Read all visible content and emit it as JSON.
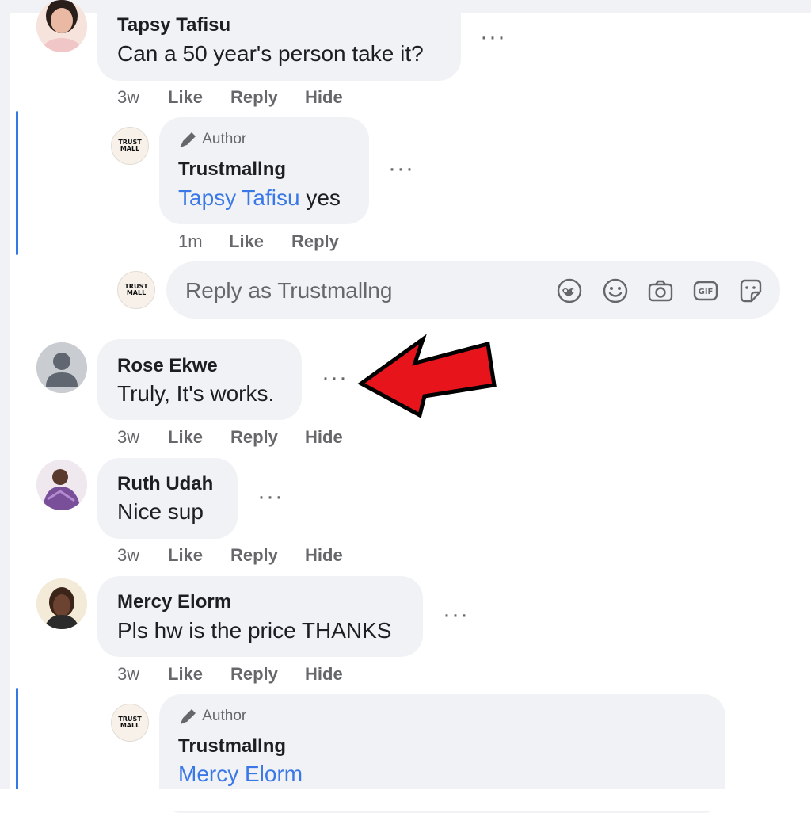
{
  "comments": [
    {
      "name": "Tapsy Tafisu",
      "text": "Can a 50 year's person take it?",
      "time": "3w",
      "like": "Like",
      "reply": "Reply",
      "hide": "Hide",
      "menu": "···"
    },
    {
      "name": "Rose Ekwe",
      "text": "Truly, It's works.",
      "time": "3w",
      "like": "Like",
      "reply": "Reply",
      "hide": "Hide",
      "menu": "···"
    },
    {
      "name": "Ruth Udah",
      "text": "Nice sup",
      "time": "3w",
      "like": "Like",
      "reply": "Reply",
      "hide": "Hide",
      "menu": "···"
    },
    {
      "name": "Mercy Elorm",
      "text": "Pls hw is the price THANKS",
      "time": "3w",
      "like": "Like",
      "reply": "Reply",
      "hide": "Hide",
      "menu": "···"
    }
  ],
  "replies": [
    {
      "badge": "Author",
      "name": "Trustmallng",
      "mention": "Tapsy Tafisu",
      "text": " yes",
      "time": "1m",
      "like": "Like",
      "reply": "Reply",
      "menu": "···"
    },
    {
      "badge": "Author",
      "name": "Trustmallng",
      "mention": "Mercy Elorm"
    }
  ],
  "reply_box": {
    "placeholder": "Reply as Trustmallng"
  },
  "page_logo": {
    "line1": "TRUST",
    "line2": "MALL"
  },
  "icons": [
    "avatar-frame-icon",
    "emoji-icon",
    "camera-icon",
    "gif-icon",
    "sticker-icon",
    "red-arrow-annotation"
  ],
  "colors": {
    "bubble": "#f0f2f5",
    "mention": "#3b78e7",
    "thread_line": "#3578e5",
    "meta_text": "#65676b",
    "annotation_arrow": "#e8141b"
  }
}
